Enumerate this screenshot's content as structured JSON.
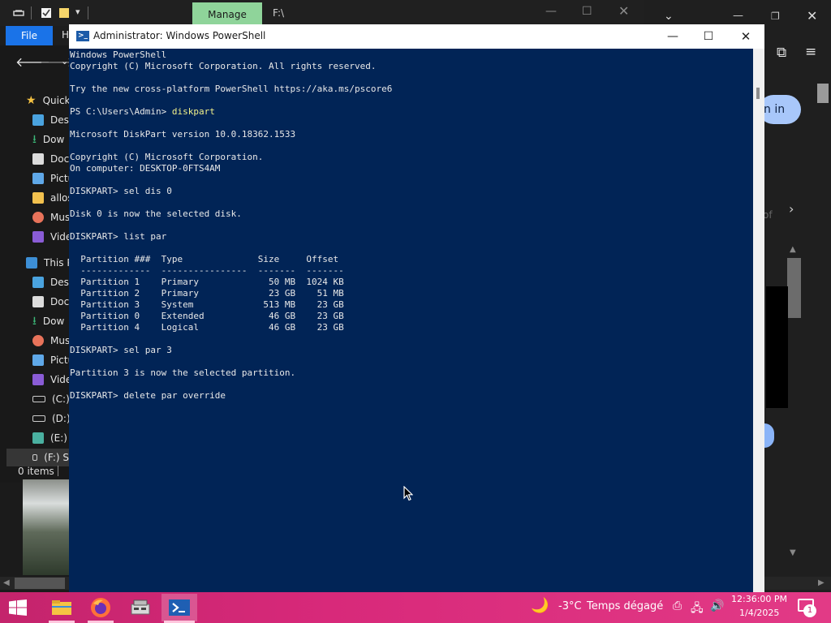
{
  "explorer": {
    "ribbon_tab_manage": "Manage",
    "path": "F:\\",
    "file_tab": "File",
    "home_tab_partial": "H",
    "status_items": "0 items",
    "sidebar": [
      {
        "label": "Quick",
        "icon": "star-icon"
      },
      {
        "label": "Desk",
        "icon": "desktop-icon"
      },
      {
        "label": "Dow",
        "icon": "download-icon"
      },
      {
        "label": "Docu",
        "icon": "document-icon"
      },
      {
        "label": "Pictu",
        "icon": "pictures-icon"
      },
      {
        "label": "allos",
        "icon": "folder-icon"
      },
      {
        "label": "Mus",
        "icon": "music-icon"
      },
      {
        "label": "Vide",
        "icon": "video-icon"
      },
      {
        "label": "This P",
        "icon": "this-pc-icon"
      },
      {
        "label": "Desk",
        "icon": "desktop-icon"
      },
      {
        "label": "Docu",
        "icon": "document-icon"
      },
      {
        "label": "Dow",
        "icon": "download-icon"
      },
      {
        "label": "Mus",
        "icon": "music-icon"
      },
      {
        "label": "Pictu",
        "icon": "pictures-icon"
      },
      {
        "label": "Vide",
        "icon": "video-icon"
      },
      {
        "label": "(C:) ",
        "icon": "drive-icon"
      },
      {
        "label": "(D:) I",
        "icon": "drive-icon"
      },
      {
        "label": "(E:) C",
        "icon": "drive-icon"
      },
      {
        "label": "(F:) S",
        "icon": "drive-icon"
      }
    ]
  },
  "browser": {
    "signin_partial": "n in",
    "grey_partial": "of"
  },
  "powershell": {
    "title": "Administrator: Windows PowerShell",
    "lines": [
      {
        "t": "Windows PowerShell"
      },
      {
        "t": "Copyright (C) Microsoft Corporation. All rights reserved."
      },
      {
        "t": ""
      },
      {
        "t": "Try the new cross-platform PowerShell https://aka.ms/pscore6"
      },
      {
        "t": ""
      },
      {
        "t": "PS C:\\Users\\Admin> ",
        "cmd": "diskpart"
      },
      {
        "t": ""
      },
      {
        "t": "Microsoft DiskPart version 10.0.18362.1533"
      },
      {
        "t": ""
      },
      {
        "t": "Copyright (C) Microsoft Corporation."
      },
      {
        "t": "On computer: DESKTOP-0FTS4AM"
      },
      {
        "t": ""
      },
      {
        "t": "DISKPART> sel dis 0"
      },
      {
        "t": ""
      },
      {
        "t": "Disk 0 is now the selected disk."
      },
      {
        "t": ""
      },
      {
        "t": "DISKPART> list par"
      },
      {
        "t": ""
      },
      {
        "t": "  Partition ###  Type              Size     Offset"
      },
      {
        "t": "  -------------  ----------------  -------  -------"
      },
      {
        "t": "  Partition 1    Primary             50 MB  1024 KB"
      },
      {
        "t": "  Partition 2    Primary             23 GB    51 MB"
      },
      {
        "t": "  Partition 3    System             513 MB    23 GB"
      },
      {
        "t": "  Partition 0    Extended            46 GB    23 GB"
      },
      {
        "t": "  Partition 4    Logical             46 GB    23 GB"
      },
      {
        "t": ""
      },
      {
        "t": "DISKPART> sel par 3"
      },
      {
        "t": ""
      },
      {
        "t": "Partition 3 is now the selected partition."
      },
      {
        "t": ""
      },
      {
        "t": "DISKPART> delete par override"
      }
    ]
  },
  "taskbar": {
    "apps": [
      {
        "name": "file-explorer-taskbar-icon"
      },
      {
        "name": "firefox-taskbar-icon"
      },
      {
        "name": "drive-tool-taskbar-icon"
      },
      {
        "name": "powershell-taskbar-icon",
        "active": true
      }
    ],
    "weather_temp": "-3°C",
    "weather_desc": "Temps dégagé",
    "clock_time": "12:36:00 PM",
    "clock_date": "1/4/2025",
    "notification_count": "1"
  }
}
